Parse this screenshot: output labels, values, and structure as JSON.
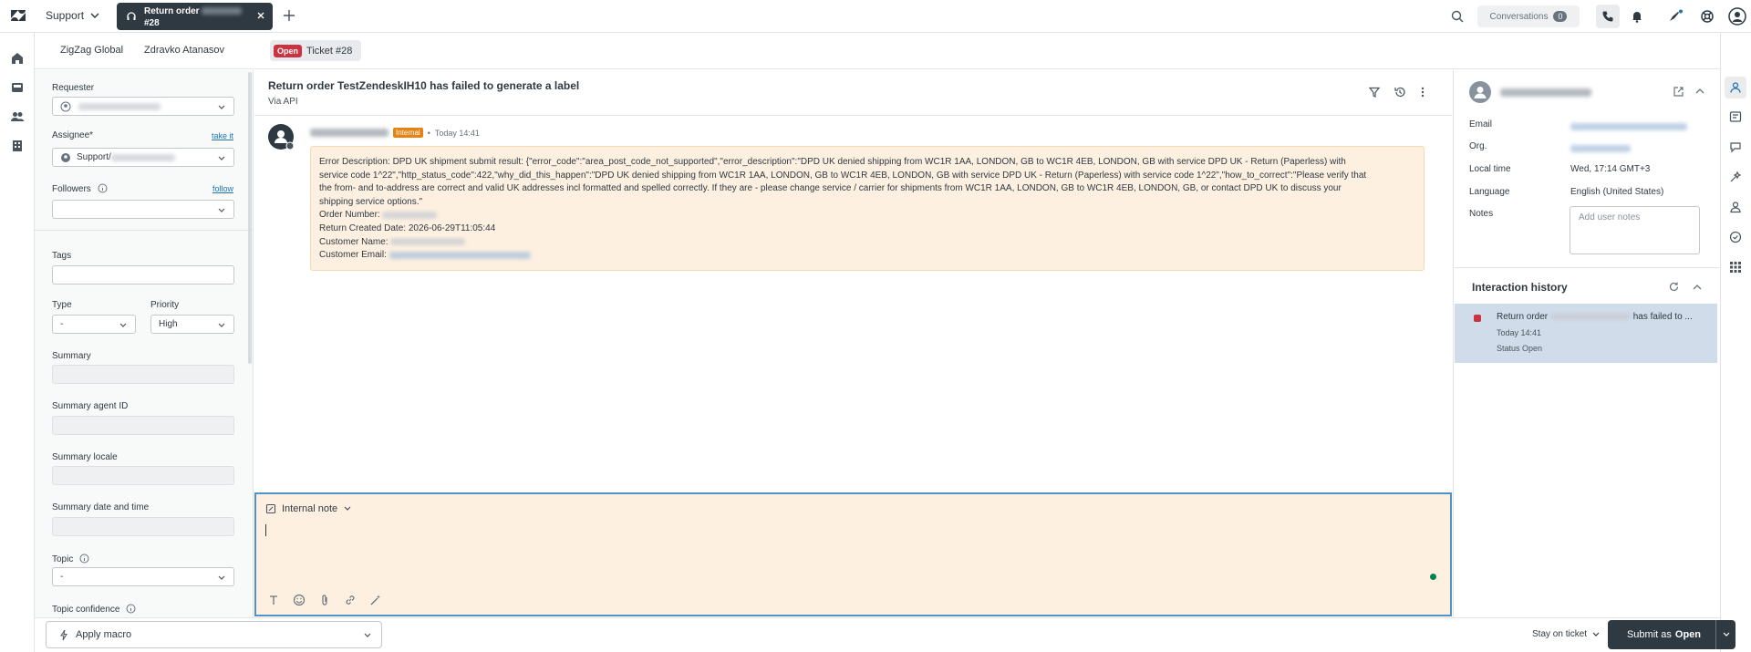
{
  "topbar": {
    "product": "Support",
    "tab_title_line1": "Return order",
    "tab_title_line2": "#28",
    "conversations_label": "Conversations",
    "conversations_count": "0"
  },
  "subtabs": {
    "org": "ZigZag Global",
    "requester": "Zdravko Atanasov",
    "status": "Open",
    "ticket": "Ticket #28"
  },
  "properties": {
    "requester_label": "Requester",
    "assignee_label": "Assignee*",
    "take_it": "take it",
    "assignee_prefix": "Support/",
    "followers_label": "Followers",
    "follow": "follow",
    "tags_label": "Tags",
    "type_label": "Type",
    "type_value": "-",
    "priority_label": "Priority",
    "priority_value": "High",
    "summary_label": "Summary",
    "summary_agent_label": "Summary agent ID",
    "summary_locale_label": "Summary locale",
    "summary_date_label": "Summary date and time",
    "topic_label": "Topic",
    "topic_value": "-",
    "topic_confidence_label": "Topic confidence"
  },
  "ticket": {
    "subject": "Return order TestZendeskIH10 has failed to generate a label",
    "via": "Via API",
    "badge": "Internal",
    "time": "Today 14:41",
    "body_lines": [
      "Error Description: DPD UK shipment submit result: {\"error_code\":\"area_post_code_not_supported\",\"error_description\":\"DPD UK denied shipping from WC1R 1AA, LONDON, GB to WC1R 4EB, LONDON, GB with service DPD UK - Return (Paperless) with",
      "service code 1^22\",\"http_status_code\":422,\"why_did_this_happen\":\"DPD UK denied shipping from WC1R 1AA, LONDON, GB to WC1R 4EB, LONDON, GB with service DPD UK - Return (Paperless) with service code 1^22\",\"how_to_correct\":\"Please verify that",
      "the from- and to-address are correct and valid UK addresses incl formatted and spelled correctly. If they are - please change service / carrier for shipments from WC1R 1AA, LONDON, GB to WC1R 4EB, LONDON, GB, or contact DPD UK to discuss your",
      "shipping service options.\""
    ],
    "order_number_label": "Order Number:",
    "return_date_line": "Return Created Date: 2026-06-29T11:05:44",
    "customer_name_label": "Customer Name:",
    "customer_email_label": "Customer Email:"
  },
  "composer": {
    "mode": "Internal note"
  },
  "context": {
    "email_label": "Email",
    "org_label": "Org.",
    "local_time_label": "Local time",
    "local_time_value": "Wed, 17:14 GMT+3",
    "language_label": "Language",
    "language_value": "English (United States)",
    "notes_label": "Notes",
    "notes_placeholder": "Add user notes",
    "ih_title": "Interaction history",
    "ih_item_prefix": "Return order",
    "ih_item_suffix": "has failed to ...",
    "ih_item_time": "Today 14:41",
    "ih_item_status_label": "Status",
    "ih_item_status_value": "Open"
  },
  "footer": {
    "macro": "Apply macro",
    "stay": "Stay on ticket",
    "submit_prefix": "Submit as",
    "submit_status": "Open"
  },
  "colors": {
    "accent": "#1f73b7",
    "open_status": "#cc3340",
    "internal_badge": "#e38215",
    "internal_bg": "#fdf0e1",
    "dark": "#2f3941"
  }
}
